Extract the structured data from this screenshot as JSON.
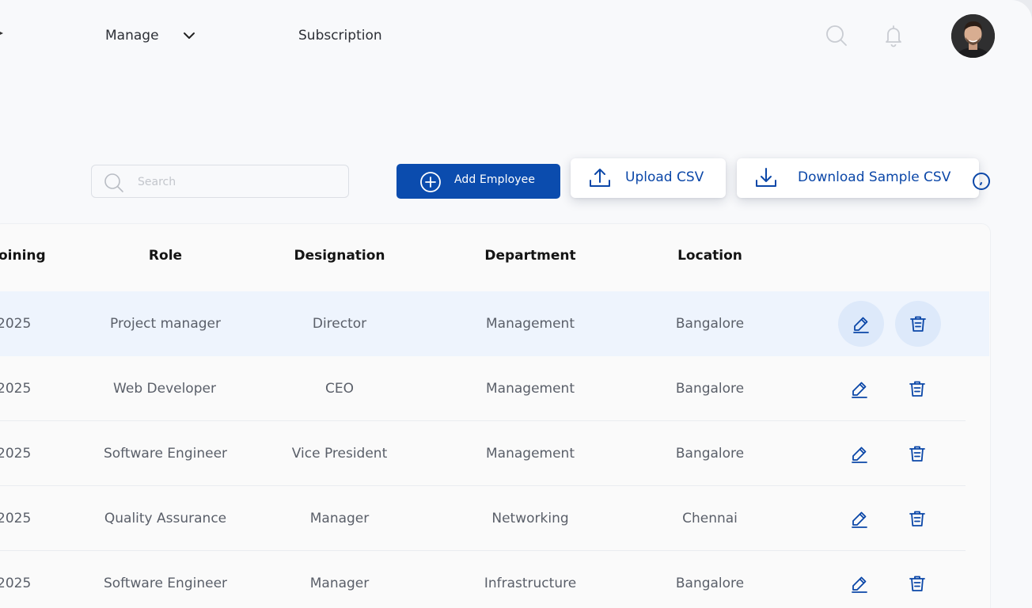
{
  "nav": {
    "manage_label": "Manage",
    "subscription_label": "Subscription"
  },
  "toolbar": {
    "search_placeholder": "Search",
    "add_employee_label": "Add Employee",
    "upload_csv_label": "Upload CSV",
    "download_csv_label": "Download Sample CSV"
  },
  "table": {
    "headers": {
      "joining": "oining",
      "role": "Role",
      "designation": "Designation",
      "department": "Department",
      "location": "Location"
    },
    "rows": [
      {
        "date": "2025",
        "role": "Project manager",
        "designation": "Director",
        "department": "Management",
        "location": "Bangalore",
        "highlighted": true
      },
      {
        "date": "2025",
        "role": "Web Developer",
        "designation": "CEO",
        "department": "Management",
        "location": "Bangalore",
        "highlighted": false
      },
      {
        "date": "2025",
        "role": "Software Engineer",
        "designation": "Vice President",
        "department": "Management",
        "location": "Bangalore",
        "highlighted": false
      },
      {
        "date": "2025",
        "role": "Quality Assurance",
        "designation": "Manager",
        "department": "Networking",
        "location": "Chennai",
        "highlighted": false
      },
      {
        "date": "2025",
        "role": "Software Engineer",
        "designation": "Manager",
        "department": "Infrastructure",
        "location": "Bangalore",
        "highlighted": false
      }
    ]
  },
  "icons": {
    "search": "search-icon",
    "bell": "bell-icon",
    "edit": "edit-icon",
    "delete": "trash-icon",
    "upload": "upload-icon",
    "download": "download-icon",
    "add": "plus-circle-icon"
  },
  "colors": {
    "primary": "#0b4cae",
    "link_blue": "#0b47a8",
    "row_highlight": "#eef4fd",
    "action_highlight": "#dde9fa"
  }
}
